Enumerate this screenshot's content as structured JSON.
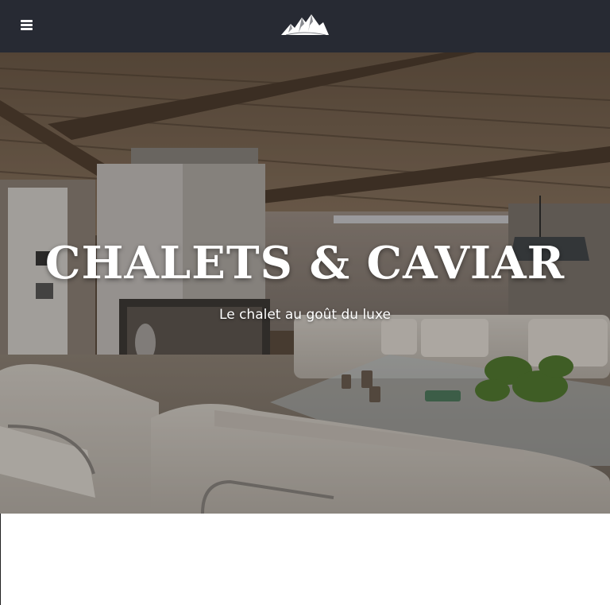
{
  "header": {
    "menu_icon": "hamburger-menu-icon",
    "logo_icon": "mountain-logo-icon",
    "background": "#272a33"
  },
  "hero": {
    "title": "CHALETS & CAVIAR",
    "subtitle": "Le chalet au goût du luxe",
    "image": "chalet-living-room-photo"
  }
}
